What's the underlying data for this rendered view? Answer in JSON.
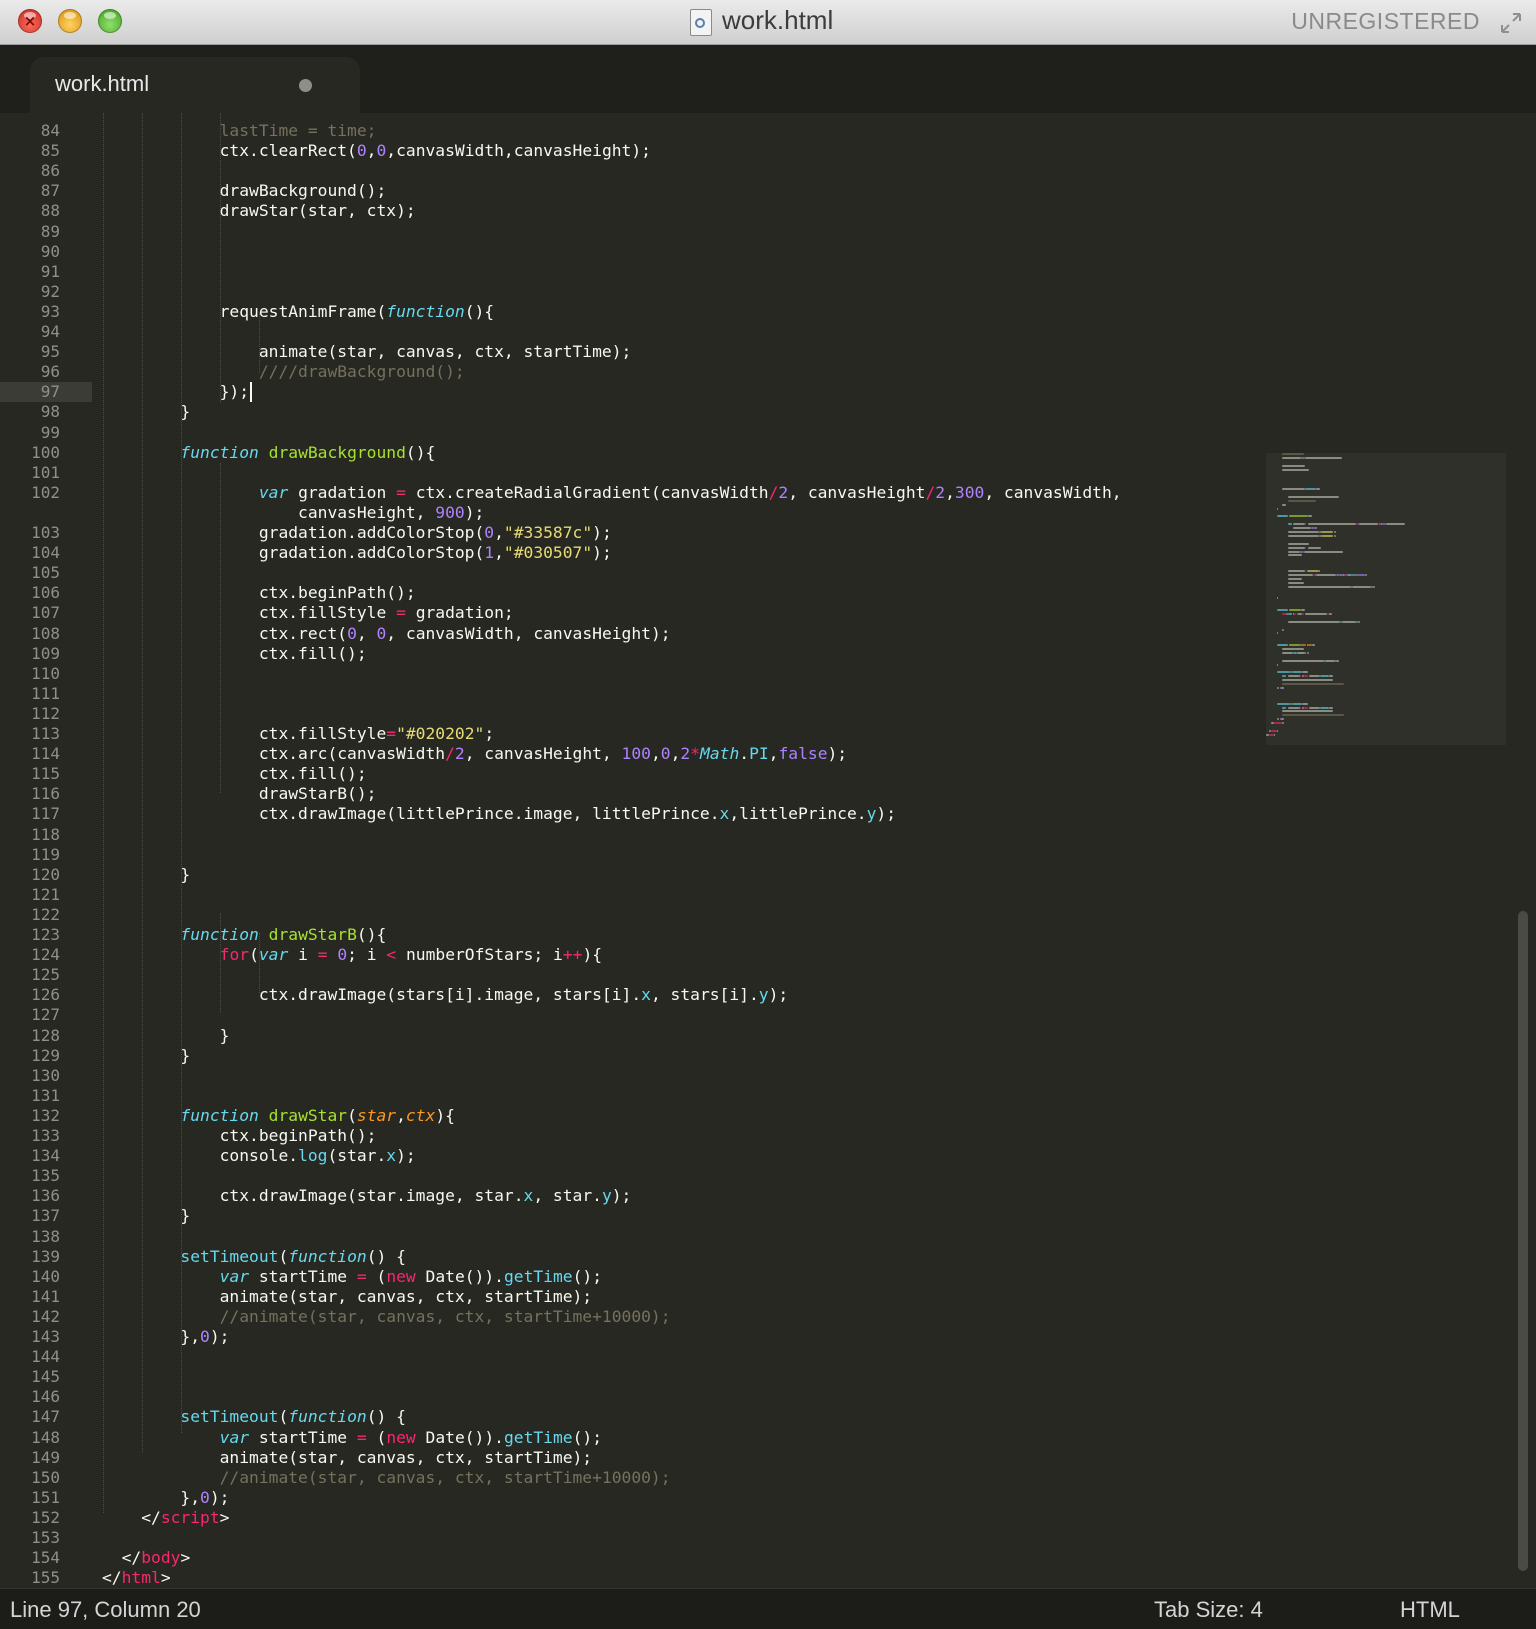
{
  "window": {
    "title": "work.html",
    "unregistered": "UNREGISTERED"
  },
  "tab": {
    "label": "work.html"
  },
  "editor": {
    "active_line": 97,
    "lines": [
      {
        "n": "84",
        "seg": [
          [
            "c",
            "            lastTime = time;"
          ]
        ]
      },
      {
        "n": "85",
        "seg": [
          [
            "t",
            "            ctx.clearRect("
          ],
          [
            "n",
            "0"
          ],
          [
            "t",
            ","
          ],
          [
            "n",
            "0"
          ],
          [
            "t",
            ",canvasWidth,canvasHeight);"
          ]
        ]
      },
      {
        "n": "86",
        "seg": []
      },
      {
        "n": "87",
        "seg": [
          [
            "t",
            "            drawBackground();"
          ]
        ]
      },
      {
        "n": "88",
        "seg": [
          [
            "t",
            "            drawStar(star, ctx);"
          ]
        ]
      },
      {
        "n": "89",
        "seg": []
      },
      {
        "n": "90",
        "seg": []
      },
      {
        "n": "91",
        "seg": []
      },
      {
        "n": "92",
        "seg": []
      },
      {
        "n": "93",
        "seg": [
          [
            "t",
            "            requestAnimFrame("
          ],
          [
            "st",
            "function"
          ],
          [
            "t",
            "(){"
          ]
        ]
      },
      {
        "n": "94",
        "seg": []
      },
      {
        "n": "95",
        "seg": [
          [
            "t",
            "                animate(star, canvas, ctx, startTime);"
          ]
        ]
      },
      {
        "n": "96",
        "seg": [
          [
            "c",
            "                ////drawBackground();"
          ]
        ]
      },
      {
        "n": "97",
        "seg": [
          [
            "t",
            "            });"
          ]
        ]
      },
      {
        "n": "98",
        "seg": [
          [
            "t",
            "        }"
          ]
        ]
      },
      {
        "n": "99",
        "seg": []
      },
      {
        "n": "100",
        "seg": [
          [
            "t",
            "        "
          ],
          [
            "st",
            "function"
          ],
          [
            "t",
            " "
          ],
          [
            "f",
            "drawBackground"
          ],
          [
            "t",
            "(){"
          ]
        ]
      },
      {
        "n": "101",
        "seg": []
      },
      {
        "n": "102",
        "seg": [
          [
            "t",
            "                "
          ],
          [
            "st",
            "var"
          ],
          [
            "t",
            " gradation "
          ],
          [
            "k",
            "="
          ],
          [
            "t",
            " ctx.createRadialGradient(canvasWidth"
          ],
          [
            "k",
            "/"
          ],
          [
            "n",
            "2"
          ],
          [
            "t",
            ", canvasHeight"
          ],
          [
            "k",
            "/"
          ],
          [
            "n",
            "2"
          ],
          [
            "t",
            ","
          ],
          [
            "n",
            "300"
          ],
          [
            "t",
            ", canvasWidth,"
          ]
        ]
      },
      {
        "n": "",
        "seg": [
          [
            "t",
            "                    canvasHeight, "
          ],
          [
            "n",
            "900"
          ],
          [
            "t",
            ");"
          ]
        ]
      },
      {
        "n": "103",
        "seg": [
          [
            "t",
            "                gradation.addColorStop("
          ],
          [
            "n",
            "0"
          ],
          [
            "t",
            ","
          ],
          [
            "s",
            "\"#33587c\""
          ],
          [
            "t",
            ");"
          ]
        ]
      },
      {
        "n": "104",
        "seg": [
          [
            "t",
            "                gradation.addColorStop("
          ],
          [
            "n",
            "1"
          ],
          [
            "t",
            ","
          ],
          [
            "s",
            "\"#030507\""
          ],
          [
            "t",
            ");"
          ]
        ]
      },
      {
        "n": "105",
        "seg": []
      },
      {
        "n": "106",
        "seg": [
          [
            "t",
            "                ctx.beginPath();"
          ]
        ]
      },
      {
        "n": "107",
        "seg": [
          [
            "t",
            "                ctx.fillStyle "
          ],
          [
            "k",
            "="
          ],
          [
            "t",
            " gradation;"
          ]
        ]
      },
      {
        "n": "108",
        "seg": [
          [
            "t",
            "                ctx.rect("
          ],
          [
            "n",
            "0"
          ],
          [
            "t",
            ", "
          ],
          [
            "n",
            "0"
          ],
          [
            "t",
            ", canvasWidth, canvasHeight);"
          ]
        ]
      },
      {
        "n": "109",
        "seg": [
          [
            "t",
            "                ctx.fill();"
          ]
        ]
      },
      {
        "n": "110",
        "seg": []
      },
      {
        "n": "111",
        "seg": []
      },
      {
        "n": "112",
        "seg": []
      },
      {
        "n": "113",
        "seg": [
          [
            "t",
            "                ctx.fillStyle"
          ],
          [
            "k",
            "="
          ],
          [
            "s",
            "\"#020202\""
          ],
          [
            "t",
            ";"
          ]
        ]
      },
      {
        "n": "114",
        "seg": [
          [
            "t",
            "                ctx.arc(canvasWidth"
          ],
          [
            "k",
            "/"
          ],
          [
            "n",
            "2"
          ],
          [
            "t",
            ", canvasHeight, "
          ],
          [
            "n",
            "100"
          ],
          [
            "t",
            ","
          ],
          [
            "n",
            "0"
          ],
          [
            "t",
            ","
          ],
          [
            "n",
            "2"
          ],
          [
            "k",
            "*"
          ],
          [
            "st",
            "Math"
          ],
          [
            "t",
            "."
          ],
          [
            "sv",
            "PI"
          ],
          [
            "t",
            ","
          ],
          [
            "n",
            "false"
          ],
          [
            "t",
            ");"
          ]
        ]
      },
      {
        "n": "115",
        "seg": [
          [
            "t",
            "                ctx.fill();"
          ]
        ]
      },
      {
        "n": "116",
        "seg": [
          [
            "t",
            "                drawStarB();"
          ]
        ]
      },
      {
        "n": "117",
        "seg": [
          [
            "t",
            "                ctx.drawImage(littlePrince.image, littlePrince."
          ],
          [
            "sv",
            "x"
          ],
          [
            "t",
            ",littlePrince."
          ],
          [
            "sv",
            "y"
          ],
          [
            "t",
            ");"
          ]
        ]
      },
      {
        "n": "118",
        "seg": []
      },
      {
        "n": "119",
        "seg": []
      },
      {
        "n": "120",
        "seg": [
          [
            "t",
            "        }"
          ]
        ]
      },
      {
        "n": "121",
        "seg": []
      },
      {
        "n": "122",
        "seg": []
      },
      {
        "n": "123",
        "seg": [
          [
            "t",
            "        "
          ],
          [
            "st",
            "function"
          ],
          [
            "t",
            " "
          ],
          [
            "f",
            "drawStarB"
          ],
          [
            "t",
            "(){"
          ]
        ]
      },
      {
        "n": "124",
        "seg": [
          [
            "t",
            "            "
          ],
          [
            "k",
            "for"
          ],
          [
            "t",
            "("
          ],
          [
            "st",
            "var"
          ],
          [
            "t",
            " i "
          ],
          [
            "k",
            "="
          ],
          [
            "t",
            " "
          ],
          [
            "n",
            "0"
          ],
          [
            "t",
            "; i "
          ],
          [
            "k",
            "<"
          ],
          [
            "t",
            " numberOfStars; i"
          ],
          [
            "k",
            "++"
          ],
          [
            "t",
            "){"
          ]
        ]
      },
      {
        "n": "125",
        "seg": []
      },
      {
        "n": "126",
        "seg": [
          [
            "t",
            "                ctx.drawImage(stars[i].image, stars[i]."
          ],
          [
            "sv",
            "x"
          ],
          [
            "t",
            ", stars[i]."
          ],
          [
            "sv",
            "y"
          ],
          [
            "t",
            ");"
          ]
        ]
      },
      {
        "n": "127",
        "seg": []
      },
      {
        "n": "128",
        "seg": [
          [
            "t",
            "            }"
          ]
        ]
      },
      {
        "n": "129",
        "seg": [
          [
            "t",
            "        }"
          ]
        ]
      },
      {
        "n": "130",
        "seg": []
      },
      {
        "n": "131",
        "seg": []
      },
      {
        "n": "132",
        "seg": [
          [
            "t",
            "        "
          ],
          [
            "st",
            "function"
          ],
          [
            "t",
            " "
          ],
          [
            "f",
            "drawStar"
          ],
          [
            "t",
            "("
          ],
          [
            "p",
            "star"
          ],
          [
            "t",
            ","
          ],
          [
            "p",
            "ctx"
          ],
          [
            "t",
            "){"
          ]
        ]
      },
      {
        "n": "133",
        "seg": [
          [
            "t",
            "            ctx.beginPath();"
          ]
        ]
      },
      {
        "n": "134",
        "seg": [
          [
            "t",
            "            console."
          ],
          [
            "sv",
            "log"
          ],
          [
            "t",
            "(star."
          ],
          [
            "sv",
            "x"
          ],
          [
            "t",
            ");"
          ]
        ]
      },
      {
        "n": "135",
        "seg": []
      },
      {
        "n": "136",
        "seg": [
          [
            "t",
            "            ctx.drawImage(star.image, star."
          ],
          [
            "sv",
            "x"
          ],
          [
            "t",
            ", star."
          ],
          [
            "sv",
            "y"
          ],
          [
            "t",
            ");"
          ]
        ]
      },
      {
        "n": "137",
        "seg": [
          [
            "t",
            "        }"
          ]
        ]
      },
      {
        "n": "138",
        "seg": []
      },
      {
        "n": "139",
        "seg": [
          [
            "t",
            "        "
          ],
          [
            "sv",
            "setTimeout"
          ],
          [
            "t",
            "("
          ],
          [
            "st",
            "function"
          ],
          [
            "t",
            "() {"
          ]
        ]
      },
      {
        "n": "140",
        "seg": [
          [
            "t",
            "            "
          ],
          [
            "st",
            "var"
          ],
          [
            "t",
            " startTime "
          ],
          [
            "k",
            "="
          ],
          [
            "t",
            " ("
          ],
          [
            "k",
            "new"
          ],
          [
            "t",
            " Date())."
          ],
          [
            "sv",
            "getTime"
          ],
          [
            "t",
            "();"
          ]
        ]
      },
      {
        "n": "141",
        "seg": [
          [
            "t",
            "            animate(star, canvas, ctx, startTime);"
          ]
        ]
      },
      {
        "n": "142",
        "seg": [
          [
            "c",
            "            //animate(star, canvas, ctx, startTime+10000);"
          ]
        ]
      },
      {
        "n": "143",
        "seg": [
          [
            "t",
            "        },"
          ],
          [
            "n",
            "0"
          ],
          [
            "t",
            ");"
          ]
        ]
      },
      {
        "n": "144",
        "seg": []
      },
      {
        "n": "145",
        "seg": []
      },
      {
        "n": "146",
        "seg": []
      },
      {
        "n": "147",
        "seg": [
          [
            "t",
            "        "
          ],
          [
            "sv",
            "setTimeout"
          ],
          [
            "t",
            "("
          ],
          [
            "st",
            "function"
          ],
          [
            "t",
            "() {"
          ]
        ]
      },
      {
        "n": "148",
        "seg": [
          [
            "t",
            "            "
          ],
          [
            "st",
            "var"
          ],
          [
            "t",
            " startTime "
          ],
          [
            "k",
            "="
          ],
          [
            "t",
            " ("
          ],
          [
            "k",
            "new"
          ],
          [
            "t",
            " Date())."
          ],
          [
            "sv",
            "getTime"
          ],
          [
            "t",
            "();"
          ]
        ]
      },
      {
        "n": "149",
        "seg": [
          [
            "t",
            "            animate(star, canvas, ctx, startTime);"
          ]
        ]
      },
      {
        "n": "150",
        "seg": [
          [
            "c",
            "            //animate(star, canvas, ctx, startTime+10000);"
          ]
        ]
      },
      {
        "n": "151",
        "seg": [
          [
            "t",
            "        },"
          ],
          [
            "n",
            "0"
          ],
          [
            "t",
            ");"
          ]
        ]
      },
      {
        "n": "152",
        "seg": [
          [
            "t",
            "    </"
          ],
          [
            "k",
            "script"
          ],
          [
            "t",
            ">"
          ]
        ]
      },
      {
        "n": "153",
        "seg": []
      },
      {
        "n": "154",
        "seg": [
          [
            "t",
            "  </"
          ],
          [
            "k",
            "body"
          ],
          [
            "t",
            ">"
          ]
        ]
      },
      {
        "n": "155",
        "seg": [
          [
            "t",
            "</"
          ],
          [
            "k",
            "html"
          ],
          [
            "t",
            ">"
          ]
        ]
      }
    ]
  },
  "status": {
    "position": "Line 97, Column 20",
    "tab_size": "Tab Size: 4",
    "syntax": "HTML"
  },
  "colors": {
    "background": "#272822",
    "text": "#f8f8f2",
    "keyword": "#f92672",
    "function_name": "#a6e22e",
    "number": "#ae81ff",
    "string": "#e6db74",
    "comment": "#75715e",
    "storage": "#66d9ef",
    "parameter": "#fd971f"
  }
}
